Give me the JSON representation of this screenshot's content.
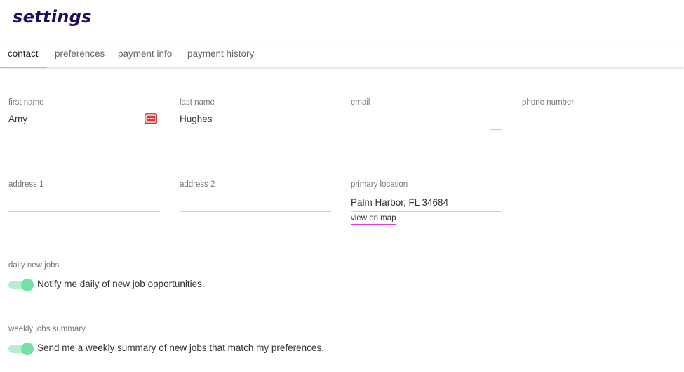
{
  "page": {
    "title": "settings"
  },
  "tabs": [
    {
      "label": "contact",
      "active": true
    },
    {
      "label": "preferences",
      "active": false
    },
    {
      "label": "payment info",
      "active": false
    },
    {
      "label": "payment history",
      "active": false
    }
  ],
  "contact": {
    "first_name": {
      "label": "first name",
      "value": "Amy"
    },
    "last_name": {
      "label": "last name",
      "value": "Hughes"
    },
    "email": {
      "label": "email",
      "value": ""
    },
    "phone": {
      "label": "phone number",
      "value": ""
    },
    "address1": {
      "label": "address 1",
      "value": ""
    },
    "address2": {
      "label": "address 2",
      "value": ""
    },
    "primary_location": {
      "label": "primary location",
      "value": "Palm Harbor, FL 34684",
      "link": "view on map"
    }
  },
  "notifications": {
    "daily": {
      "label": "daily new jobs",
      "text": "Notify me daily of new job opportunities.",
      "enabled": true
    },
    "weekly": {
      "label": "weekly jobs summary",
      "text": "Send me a weekly summary of new jobs that match my preferences.",
      "enabled": true
    }
  },
  "icons": {
    "password_manager": "password-dots-icon"
  },
  "colors": {
    "title": "#1e0f5e",
    "accent_green": "#6fe3a8",
    "link_underline": "#d63ad8",
    "pw_icon": "#d63a3a"
  }
}
